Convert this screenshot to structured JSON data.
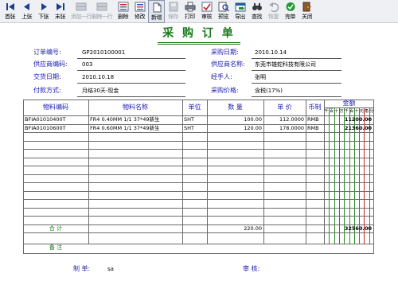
{
  "toolbar": {
    "first": "首张",
    "prev": "上张",
    "next": "下张",
    "last": "末张",
    "add_row": "添加一行",
    "delete_row": "删除一行",
    "delete": "删除",
    "edit": "修改",
    "new": "新增",
    "save": "保存",
    "print": "打印",
    "audit": "审核",
    "preview": "预览",
    "export": "导出",
    "find": "查找",
    "restore": "恢复",
    "done": "完单",
    "close": "关闭"
  },
  "form": {
    "title": "采 购 订 单",
    "order_no_label": "订单编号:",
    "order_no": "GP2010100001",
    "purchase_date_label": "采购日期:",
    "purchase_date": "2010.10.14",
    "supplier_code_label": "供应商编码:",
    "supplier_code": "003",
    "supplier_name_label": "供应商名称:",
    "supplier_name": "东莞市雄蛇科技有限公司",
    "delivery_date_label": "交货日期:",
    "delivery_date": "2010.10.18",
    "handler_label": "经手人:",
    "handler": "张明",
    "payment_label": "付款方式:",
    "payment": "月结30天-现金",
    "price_label": "采购价格:",
    "price": "含税(17%)"
  },
  "table": {
    "headers": {
      "code": "物料编码",
      "name": "物料名称",
      "unit": "单位",
      "qty": "数 量",
      "price": "单 价",
      "currency": "币制",
      "amount": "金额"
    },
    "digit_labels": [
      "千",
      "百",
      "十",
      "万",
      "千",
      "百",
      "十",
      "元",
      "角",
      "分"
    ],
    "rows": [
      {
        "code": "BFIA01010400T",
        "name": "FR4 0.40MM 1/1 37*49新生",
        "unit": "SHT",
        "qty": "100.00",
        "price": "112.0000",
        "currency": "RMB",
        "amount": "11200.00"
      },
      {
        "code": "BFIA01010600T",
        "name": "FR4 0.60MM 1/1 37*49新生",
        "unit": "SHT",
        "qty": "120.00",
        "price": "178.0000",
        "currency": "RMB",
        "amount": "21360.00"
      }
    ],
    "total_label": "合 计",
    "total_qty": "220.00",
    "total_amount": "32560.00",
    "remark_label": "备 注"
  },
  "footer": {
    "maker_label": "制   单:",
    "maker": "sa",
    "auditor_label": "审   核:"
  },
  "colors": {
    "label_blue": "#1a1ab0",
    "title_green": "#1a7a1a",
    "red_line": "#d02020"
  }
}
